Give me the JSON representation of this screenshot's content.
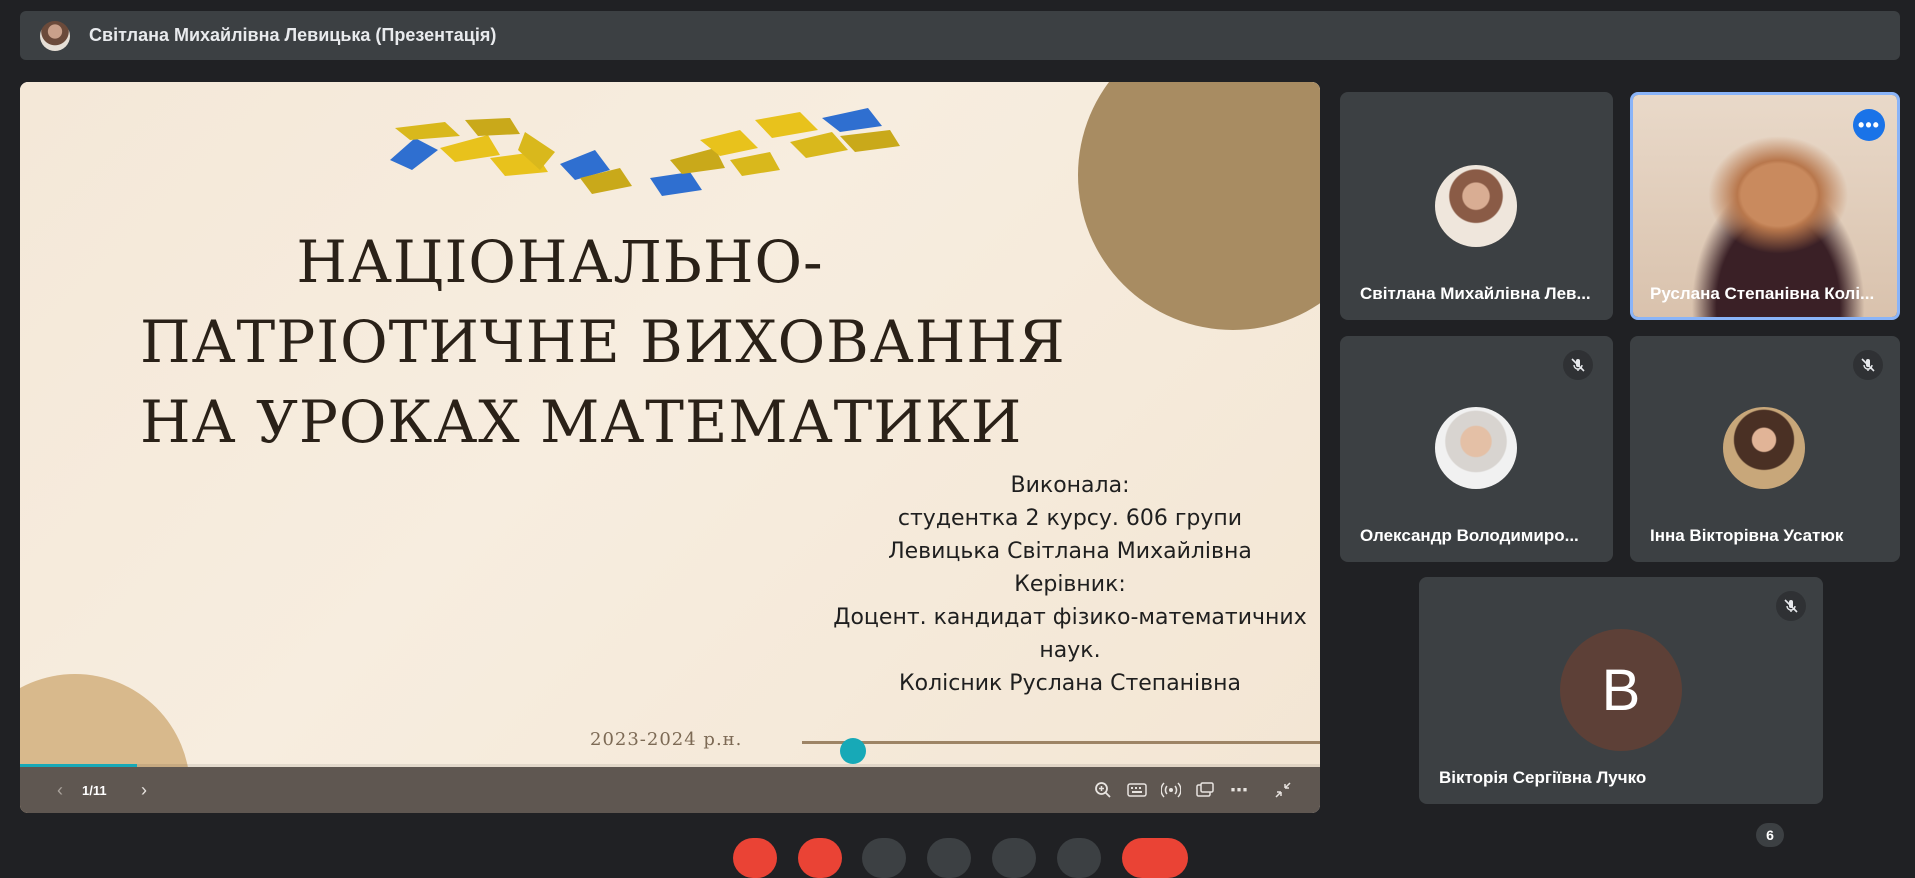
{
  "header": {
    "title": "Світлана Михайлівна Левицька (Презентація)"
  },
  "slide": {
    "title_lines": [
      "НАЦІОНАЛЬНО-",
      "ПАТРІОТИЧНЕ ВИХОВАННЯ",
      "НА УРОКАХ МАТЕМАТИКИ"
    ],
    "info_lines": [
      "Виконала:",
      "студентка 2 курсу. 606 групи",
      "Левицька Світлана Михайлівна",
      "Керівник:",
      "Доцент. кандидат фізико-математичних",
      "наук.",
      "Колісник Руслана Степанівна"
    ],
    "year": "2023-2024 р.н.",
    "colors": {
      "yellow": "#e8c21c",
      "blue": "#2f6fd0",
      "brown_circle": "#a88c62"
    }
  },
  "presentation_controls": {
    "page_indicator": "1/11",
    "progress": 0.09,
    "icons": [
      "zoom-icon",
      "keyboard-icon",
      "broadcast-icon",
      "picture-in-picture-icon",
      "more-icon",
      "exit-fullscreen-icon"
    ]
  },
  "participants": [
    {
      "name": "Світлана Михайлівна Лев...",
      "muted": false
    },
    {
      "name": "Руслана Степанівна Колі...",
      "muted": false,
      "active_speaker": true
    },
    {
      "name": "Олександр Володимиро...",
      "muted": true
    },
    {
      "name": "Інна Вікторівна Усатюк",
      "muted": true
    },
    {
      "name": "Вікторія Сергіївна Лучко",
      "muted": true,
      "initial": "В"
    }
  ],
  "participant_count": "6",
  "accent_color": "#8ab4f8"
}
